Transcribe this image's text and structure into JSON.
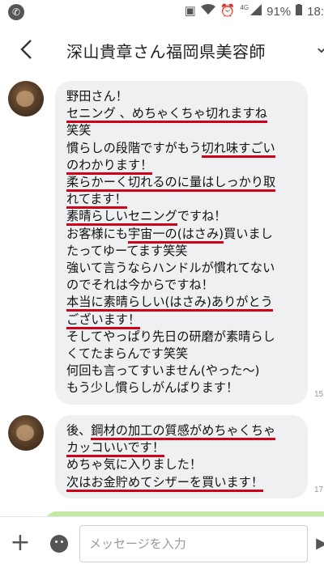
{
  "status_bar": {
    "phone_icon": "phone-icon",
    "network_label": "4G",
    "battery_text": "91%",
    "time_text": "18:"
  },
  "header": {
    "back_icon": "chevron-left-icon",
    "title": "深山貴章さん福岡県美容師"
  },
  "messages": [
    {
      "lines": [
        {
          "segments": [
            {
              "text": "野田さん！",
              "ul": false
            }
          ]
        },
        {
          "segments": [
            {
              "text": "セニング 、めちゃくちゃ切れますね",
              "ul": true
            }
          ]
        },
        {
          "segments": [
            {
              "text": "笑笑",
              "ul": false
            }
          ]
        },
        {
          "segments": [
            {
              "text": "慣らしの段階ですがもう",
              "ul": false
            },
            {
              "text": "切れ味すごい",
              "ul": true
            }
          ]
        },
        {
          "segments": [
            {
              "text": "のわかります！",
              "ul": true
            }
          ]
        },
        {
          "segments": [
            {
              "text": "柔らかーく切れるのに量はしっかり取",
              "ul": true
            }
          ]
        },
        {
          "segments": [
            {
              "text": "れてます！",
              "ul": true
            }
          ]
        },
        {
          "segments": [
            {
              "text": "素晴らしいセニング",
              "ul": true
            },
            {
              "text": "ですね！",
              "ul": false
            }
          ]
        },
        {
          "segments": [
            {
              "text": "お客様にも",
              "ul": false
            },
            {
              "text": "宇宙一の(はさみ)",
              "ul": true
            },
            {
              "text": "買いまし",
              "ul": false
            }
          ]
        },
        {
          "segments": [
            {
              "text": "たってゆーてます笑笑",
              "ul": false
            }
          ]
        },
        {
          "segments": [
            {
              "text": "強いて言うならハンドルが慣れてない",
              "ul": false
            }
          ]
        },
        {
          "segments": [
            {
              "text": "のでそれは今からですね！",
              "ul": false
            }
          ]
        },
        {
          "segments": [
            {
              "text": "本当に素晴らしい(はさみ)ありがとう",
              "ul": true
            }
          ]
        },
        {
          "segments": [
            {
              "text": "ございます！",
              "ul": true
            }
          ]
        },
        {
          "segments": [
            {
              "text": "そしてやっぱり先日の研磨が素晴らし",
              "ul": false
            }
          ]
        },
        {
          "segments": [
            {
              "text": "くてたまらんです笑笑",
              "ul": false
            }
          ]
        },
        {
          "segments": [
            {
              "text": "何回も言ってすいません(やった〜)",
              "ul": false
            }
          ]
        },
        {
          "segments": [
            {
              "text": "もう少し慣らしがんばります！",
              "ul": false
            }
          ]
        }
      ],
      "time": "15"
    },
    {
      "lines": [
        {
          "segments": [
            {
              "text": "後、",
              "ul": false
            },
            {
              "text": "鋼材の加工の質感がめちゃくちゃ",
              "ul": true
            }
          ]
        },
        {
          "segments": [
            {
              "text": "カッコいいです！",
              "ul": true
            }
          ]
        },
        {
          "segments": [
            {
              "text": "めちゃ気に入りました！",
              "ul": false
            }
          ]
        },
        {
          "segments": [
            {
              "text": "次はお金貯めてシザーを買います！",
              "ul": true
            }
          ]
        }
      ],
      "time": "17"
    }
  ],
  "input_bar": {
    "plus_icon": "plus-icon",
    "sticker_icon": "sticker-icon",
    "placeholder": "メッセージを入力"
  },
  "colors": {
    "bubble": "#eef0f2",
    "underline": "#d0021b",
    "outgoing_bubble": "#c3e9a4"
  }
}
